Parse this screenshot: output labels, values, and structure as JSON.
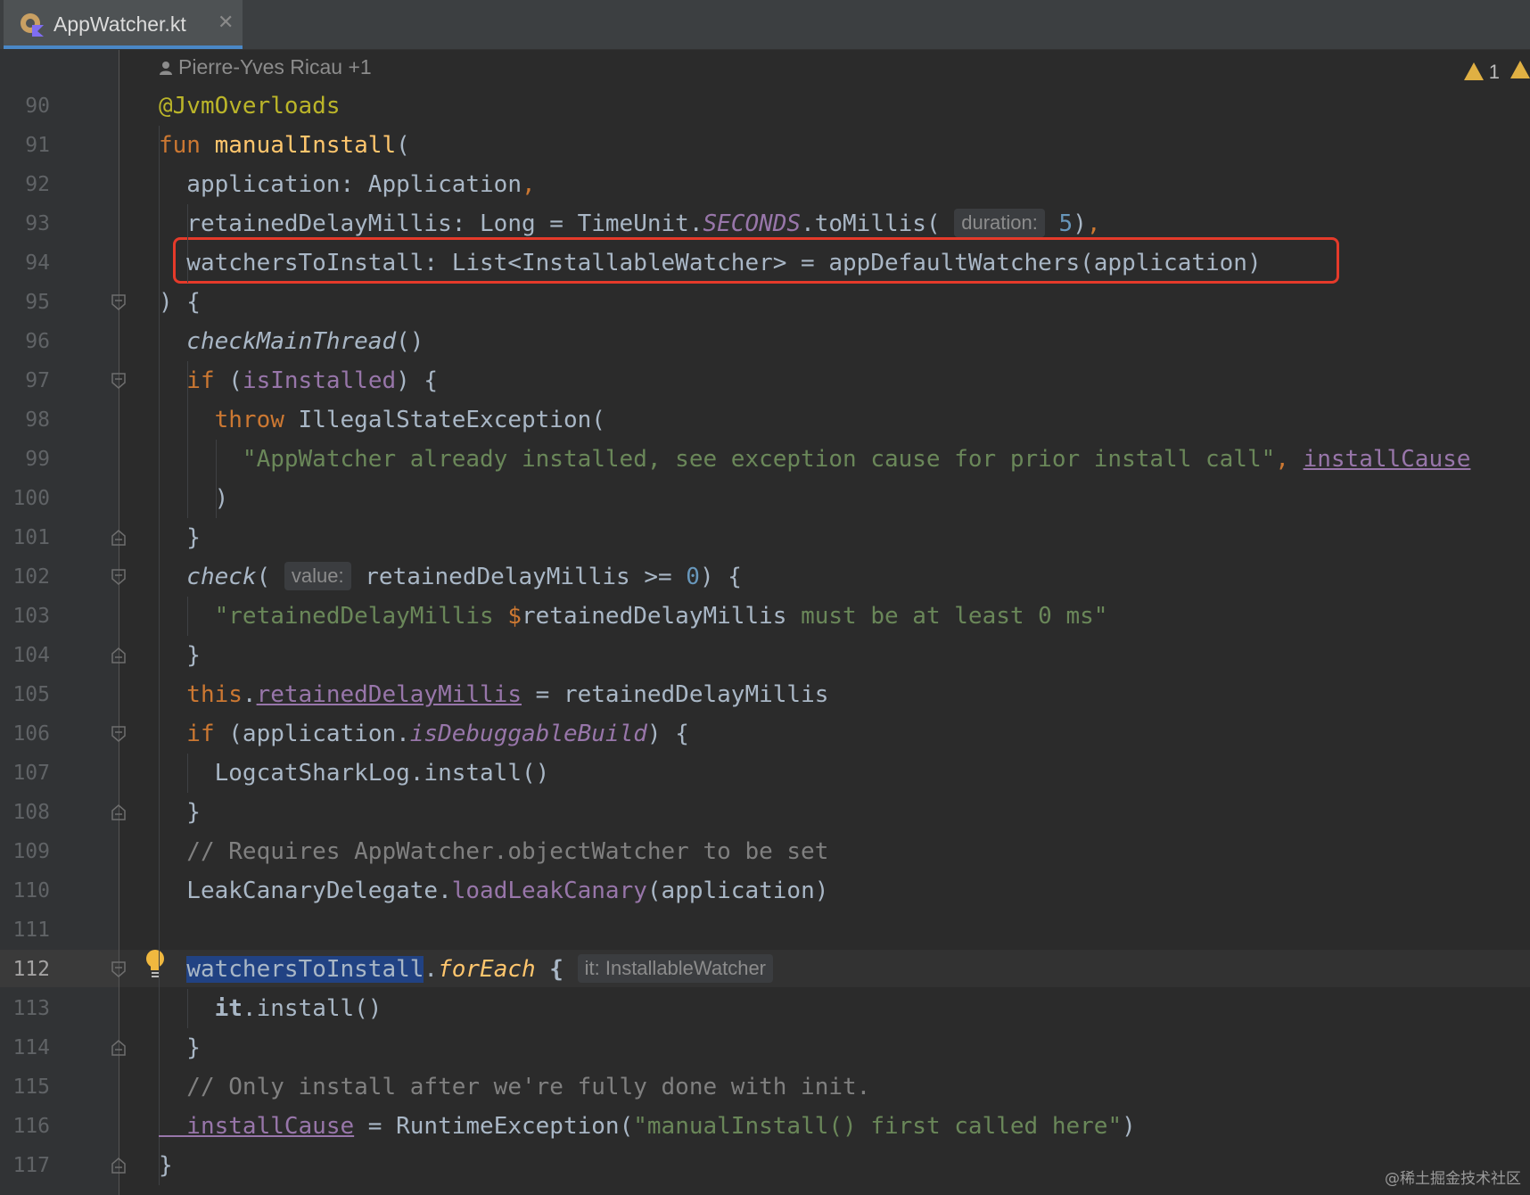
{
  "tab": {
    "filename": "AppWatcher.kt",
    "close_glyph": "✕",
    "icon": "kotlin-file-icon"
  },
  "author_line": "Pierre-Yves Ricau +1",
  "warnings": {
    "count": "1"
  },
  "lines": [
    {
      "n": "90",
      "code": [
        [
          "ann",
          "@JvmOverloads"
        ]
      ]
    },
    {
      "n": "91",
      "code": [
        [
          "kw",
          "fun "
        ],
        [
          "fn",
          "manualInstall"
        ],
        [
          "p",
          "("
        ]
      ]
    },
    {
      "n": "92",
      "code": [
        [
          "p",
          "  application: Application"
        ],
        [
          "kw",
          ","
        ]
      ]
    },
    {
      "n": "93",
      "code": [
        [
          "p",
          "  retainedDelayMillis: Long = TimeUnit."
        ],
        [
          "purple it",
          "SECONDS"
        ],
        [
          "p",
          ".toMillis( "
        ],
        [
          "hint",
          "duration:"
        ],
        [
          "num",
          " 5"
        ],
        [
          "p",
          ")"
        ],
        [
          "kw",
          ","
        ]
      ]
    },
    {
      "n": "94",
      "code": [
        [
          "p",
          "  watchersToInstall: List<InstallableWatcher> = appDefaultWatchers(application)"
        ]
      ]
    },
    {
      "n": "95",
      "code": [
        [
          "p",
          ") {"
        ]
      ]
    },
    {
      "n": "96",
      "code": [
        [
          "it",
          "  checkMainThread"
        ],
        [
          "p",
          "()"
        ]
      ]
    },
    {
      "n": "97",
      "code": [
        [
          "kw",
          "  if "
        ],
        [
          "p",
          "("
        ],
        [
          "purple",
          "isInstalled"
        ],
        [
          "p",
          ") {"
        ]
      ]
    },
    {
      "n": "98",
      "code": [
        [
          "kw",
          "    throw "
        ],
        [
          "p",
          "IllegalStateException("
        ]
      ]
    },
    {
      "n": "99",
      "code": [
        [
          "str",
          "      \"AppWatcher already installed, see exception cause for prior install call\""
        ],
        [
          "kw",
          ", "
        ],
        [
          "prop",
          "installCause"
        ]
      ]
    },
    {
      "n": "100",
      "code": [
        [
          "p",
          "    )"
        ]
      ]
    },
    {
      "n": "101",
      "code": [
        [
          "p",
          "  }"
        ]
      ]
    },
    {
      "n": "102",
      "code": [
        [
          "it",
          "  check"
        ],
        [
          "p",
          "( "
        ],
        [
          "hint",
          "value:"
        ],
        [
          "p",
          " retainedDelayMillis >= "
        ],
        [
          "num",
          "0"
        ],
        [
          "p",
          ") {"
        ]
      ]
    },
    {
      "n": "103",
      "code": [
        [
          "str",
          "    \"retainedDelayMillis "
        ],
        [
          "kw",
          "$"
        ],
        [
          "p",
          "retainedDelayMillis"
        ],
        [
          "str",
          " must be at least 0 ms\""
        ]
      ]
    },
    {
      "n": "104",
      "code": [
        [
          "p",
          "  }"
        ]
      ]
    },
    {
      "n": "105",
      "code": [
        [
          "kw",
          "  this"
        ],
        [
          "p",
          "."
        ],
        [
          "prop",
          "retainedDelayMillis"
        ],
        [
          "p",
          " = retainedDelayMillis"
        ]
      ]
    },
    {
      "n": "106",
      "code": [
        [
          "kw",
          "  if "
        ],
        [
          "p",
          "(application."
        ],
        [
          "purple it",
          "isDebuggableBuild"
        ],
        [
          "p",
          ") {"
        ]
      ]
    },
    {
      "n": "107",
      "code": [
        [
          "p",
          "    LogcatSharkLog.install()"
        ]
      ]
    },
    {
      "n": "108",
      "code": [
        [
          "p",
          "  }"
        ]
      ]
    },
    {
      "n": "109",
      "code": [
        [
          "cmt",
          "  // Requires AppWatcher.objectWatcher to be set"
        ]
      ]
    },
    {
      "n": "110",
      "code": [
        [
          "p",
          "  LeakCanaryDelegate."
        ],
        [
          "purple",
          "loadLeakCanary"
        ],
        [
          "p",
          "(application)"
        ]
      ]
    },
    {
      "n": "111",
      "code": []
    },
    {
      "n": "112",
      "code": [
        [
          "p",
          "  "
        ],
        [
          "sel",
          "watchersToInstall"
        ],
        [
          "p",
          "."
        ],
        [
          "fn it",
          "forEach"
        ],
        [
          "wb",
          " { "
        ],
        [
          "hint",
          "it: InstallableWatcher"
        ]
      ]
    },
    {
      "n": "113",
      "code": [
        [
          "wb",
          "    it"
        ],
        [
          "p",
          ".install()"
        ]
      ]
    },
    {
      "n": "114",
      "code": [
        [
          "p",
          "  }"
        ]
      ]
    },
    {
      "n": "115",
      "code": [
        [
          "cmt",
          "  // Only install after we're fully done with init."
        ]
      ]
    },
    {
      "n": "116",
      "code": [
        [
          "prop",
          "  installCause"
        ],
        [
          "p",
          " = RuntimeException("
        ],
        [
          "str",
          "\"manualInstall() first called here\""
        ],
        [
          "p",
          ")"
        ]
      ]
    },
    {
      "n": "117",
      "code": [
        [
          "p",
          "}"
        ]
      ]
    }
  ],
  "current_line": "112",
  "highlighted_line": "94",
  "watermark": "@稀土掘金技术社区"
}
